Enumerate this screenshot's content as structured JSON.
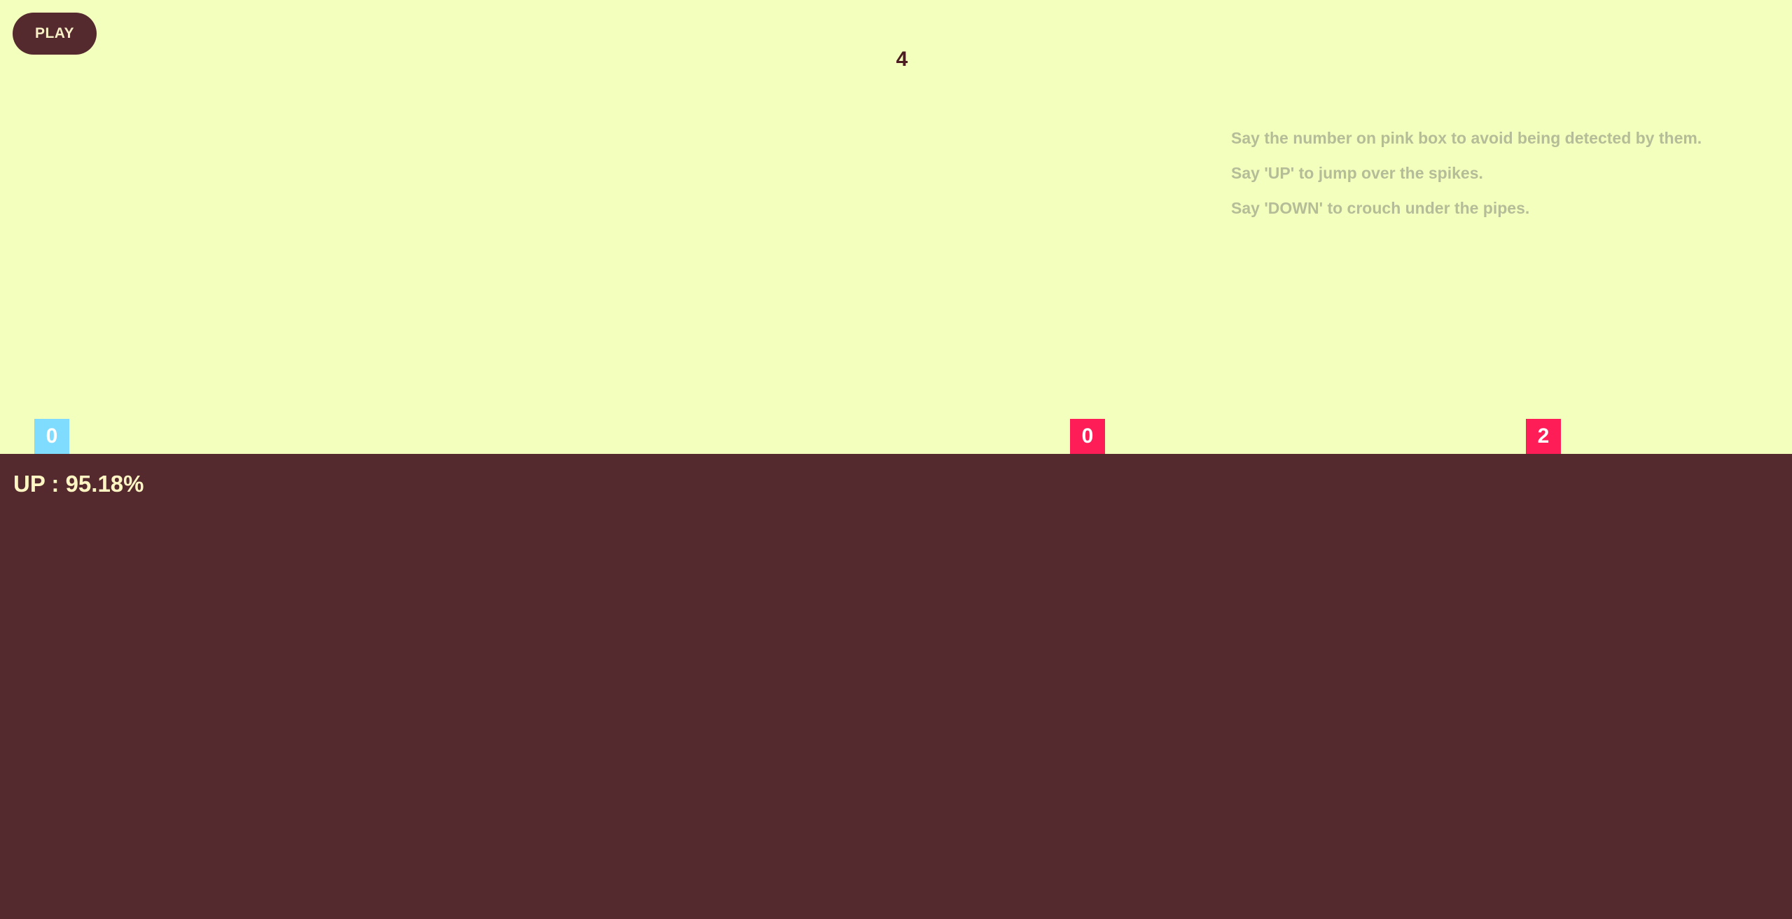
{
  "controls": {
    "play_label": "PLAY"
  },
  "hud": {
    "score": "4",
    "prediction_label": "UP : 95.18%"
  },
  "instructions": [
    "Say the number on pink box to avoid being detected by them.",
    "Say 'UP' to jump over the spikes.",
    "Say 'DOWN' to crouch under the pipes."
  ],
  "game": {
    "player": {
      "label": "0",
      "color": "#7fdcff"
    },
    "enemies": [
      {
        "label": "0",
        "color": "#ff1d58"
      },
      {
        "label": "2",
        "color": "#ff1d58"
      }
    ]
  },
  "colors": {
    "sky": "#f2ffbd",
    "ground": "#542a2f",
    "accent_text": "#fff6c4",
    "instruction_text": "#b4bd98"
  }
}
